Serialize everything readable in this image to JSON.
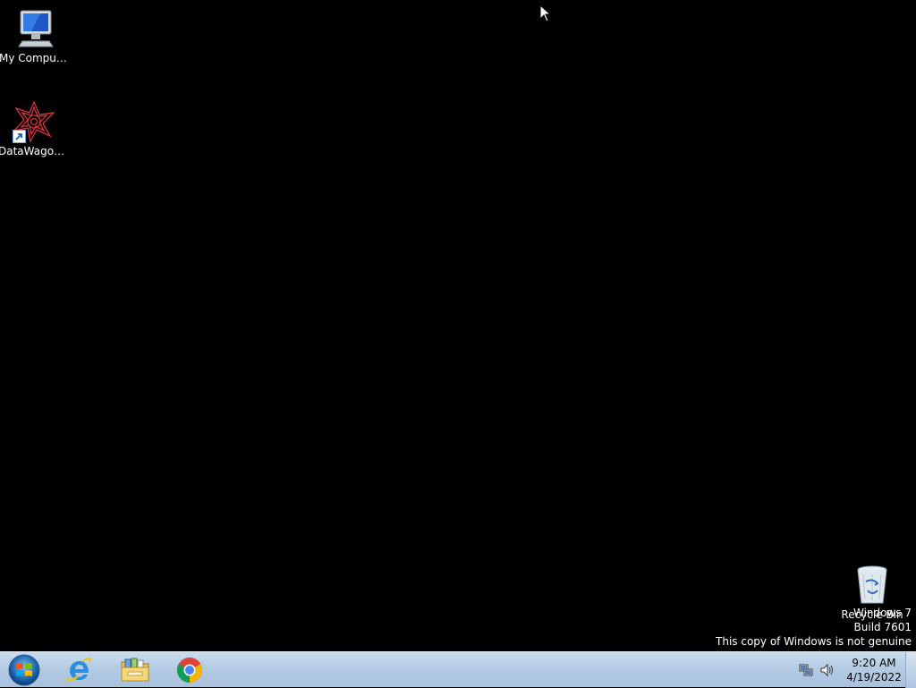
{
  "desktop": {
    "icons": [
      {
        "label": "My Computer",
        "icon": "computer-icon"
      },
      {
        "label": "DataWagon...",
        "icon": "datawagon-icon"
      },
      {
        "label": "Recycle Bin",
        "icon": "recycle-bin-icon"
      }
    ],
    "watermark": {
      "line1": "Windows 7",
      "line2": "Build 7601",
      "line3": "This copy of Windows is not genuine"
    }
  },
  "taskbar": {
    "start": {
      "icon": "windows-orb-icon"
    },
    "pinned": [
      {
        "name": "Internet Explorer",
        "icon": "internet-explorer-icon"
      },
      {
        "name": "Windows Explorer",
        "icon": "folder-library-icon"
      },
      {
        "name": "Google Chrome",
        "icon": "chrome-icon"
      }
    ],
    "tray": {
      "icons": [
        "network-icon",
        "volume-icon"
      ],
      "time": "9:20 AM",
      "date": "4/19/2022"
    }
  },
  "colors": {
    "desktop_background": "#000000",
    "taskbar_top": "#c9dcef",
    "taskbar_bottom": "#a8c1de"
  }
}
